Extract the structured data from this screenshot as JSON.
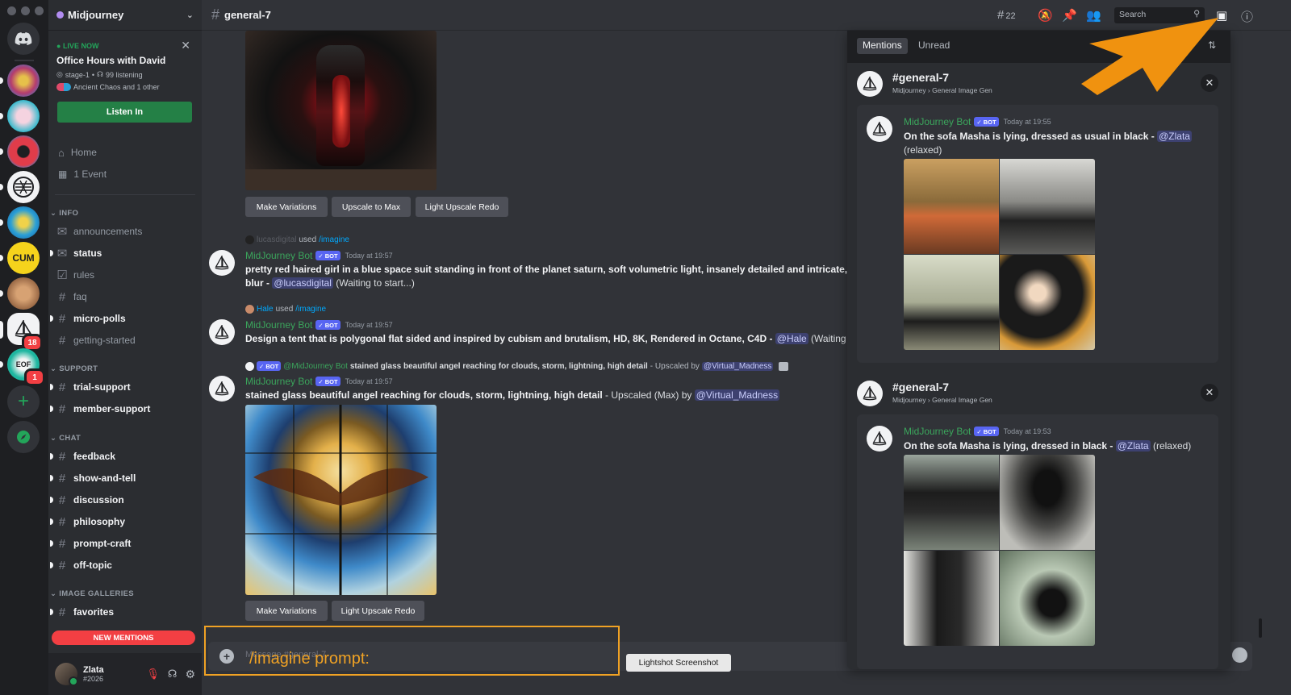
{
  "app": {
    "server_name": "Midjourney",
    "channel": "general-7"
  },
  "stage": {
    "live_label": "LIVE NOW",
    "title": "Office Hours with David",
    "stage_name": "stage-1",
    "listening": "99 listening",
    "speakers": "Ancient Chaos and 1 other",
    "listen_button": "Listen In"
  },
  "nav": {
    "home": "Home",
    "event": "1 Event"
  },
  "categories": {
    "info": "INFO",
    "support": "SUPPORT",
    "chat": "CHAT",
    "galleries": "IMAGE GALLERIES"
  },
  "channels": {
    "announcements": "announcements",
    "status": "status",
    "rules": "rules",
    "faq": "faq",
    "micro_polls": "micro-polls",
    "getting_started": "getting-started",
    "trial_support": "trial-support",
    "member_support": "member-support",
    "feedback": "feedback",
    "show_and_tell": "show-and-tell",
    "discussion": "discussion",
    "philosophy": "philosophy",
    "prompt_craft": "prompt-craft",
    "off_topic": "off-topic",
    "favorites": "favorites"
  },
  "new_mentions": "NEW MENTIONS",
  "server_badges": {
    "sailboat": "18",
    "eof": "1",
    "eof_label": "EOF",
    "cum_label": "CUM"
  },
  "user": {
    "name": "Zlata",
    "tag": "#2026"
  },
  "topbar": {
    "threads_count": "22",
    "search_placeholder": "Search"
  },
  "messages": {
    "buttons_1": [
      "Make Variations",
      "Upscale to Max",
      "Light Upscale Redo"
    ],
    "msg2": {
      "user": "lucasdigital",
      "used": "used",
      "command": "/imagine",
      "author": "MidJourney Bot",
      "badge": "BOT",
      "time": "Today at 19:57",
      "prompt": "pretty red haired girl in a blue space suit standing in front of the planet saturn, soft volumetric light, insanely detailed and intricate, extrem",
      "line2_prefix": "blur - ",
      "mention": "@lucasdigital",
      "status": "(Waiting to start...)"
    },
    "msg3": {
      "user": "Hale",
      "used": "used",
      "command": "/imagine",
      "author": "MidJourney Bot",
      "badge": "BOT",
      "time": "Today at 19:57",
      "prompt": "Design a tent that is polygonal flat sided and inspired by cubism and brutalism, HD, 8K, Rendered in Octane, C4D",
      "separator": " - ",
      "mention": "@Hale",
      "status": "(Waiting to start"
    },
    "msg4": {
      "reply_badge": "BOT",
      "reply_author": "@MidJourney Bot",
      "reply_text": "stained glass beautiful angel reaching for clouds, storm, lightning,  high detail",
      "reply_suffix": " - Upscaled by ",
      "reply_mention": "@Virtual_Madness",
      "author": "MidJourney Bot",
      "badge": "BOT",
      "time": "Today at 19:57",
      "prompt": "stained glass beautiful angel reaching for clouds, storm, lightning,  high detail",
      "suffix": " - Upscaled (Max) by ",
      "mention": "@Virtual_Madness"
    },
    "buttons_4": [
      "Make Variations",
      "Light Upscale Redo"
    ]
  },
  "composer": {
    "placeholder": "Message #general-7",
    "overlay_text": "/imagine prompt:",
    "tooltip": "Lightshot Screenshot"
  },
  "inbox": {
    "tabs": [
      "Mentions",
      "Unread"
    ],
    "groups": [
      {
        "channel": "#general-7",
        "path": "Midjourney › General Image Gen",
        "author": "MidJourney Bot",
        "badge": "BOT",
        "time": "Today at 19:55",
        "prompt": "On the sofa Masha is lying, dressed as usual in black",
        "separator": " - ",
        "mention": "@Zlata",
        "status": "(relaxed)"
      },
      {
        "channel": "#general-7",
        "path": "Midjourney › General Image Gen",
        "author": "MidJourney Bot",
        "badge": "BOT",
        "time": "Today at 19:53",
        "prompt": "On the sofa Masha  is lying, dressed in black",
        "separator": " - ",
        "mention": "@Zlata",
        "status": "(relaxed)"
      }
    ]
  },
  "colors": {
    "accent": "#5865f2",
    "bot_name": "#3ba55c",
    "live": "#23a55a",
    "danger": "#f23f43",
    "highlight": "#f0a224",
    "link": "#00a8fc"
  }
}
